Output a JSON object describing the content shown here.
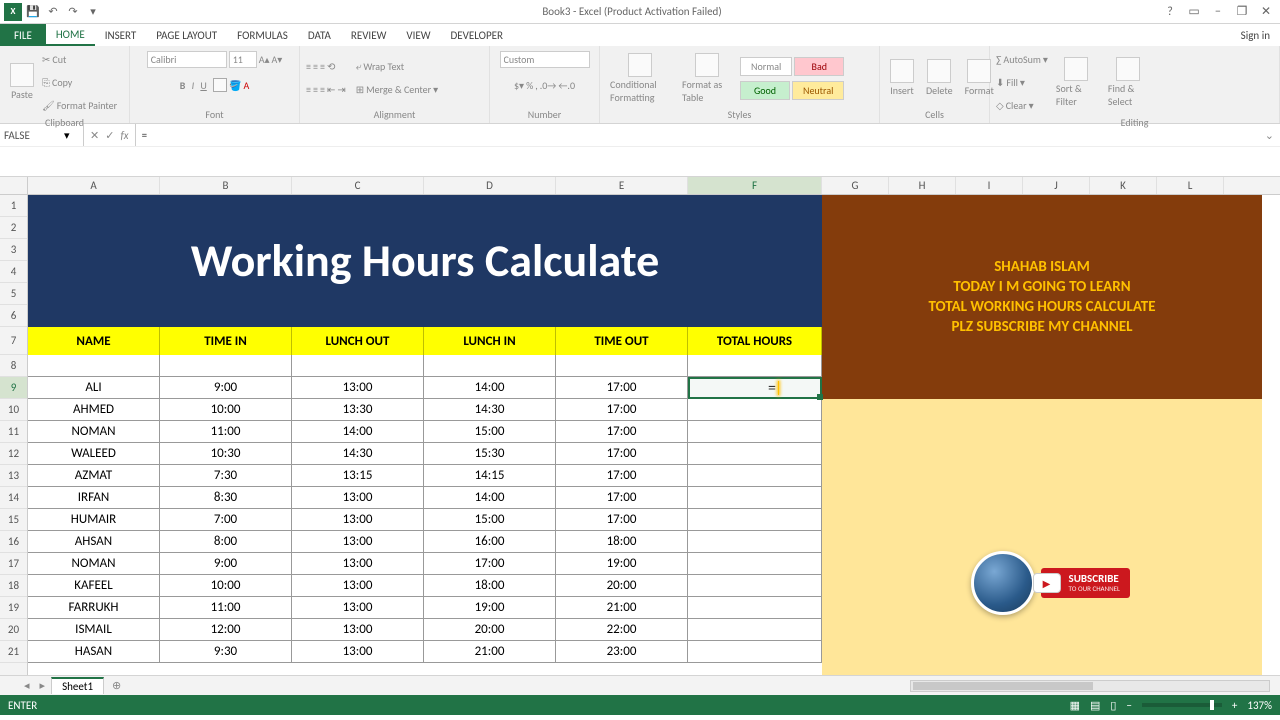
{
  "title_bar": {
    "app_title": "Book3 - Excel (Product Activation Failed)"
  },
  "window_controls": {
    "help": "?",
    "ribbon_opts": "▭",
    "minimize": "−",
    "restore": "❐",
    "close": "✕"
  },
  "tabs": {
    "file": "FILE",
    "home": "HOME",
    "insert": "INSERT",
    "page_layout": "PAGE LAYOUT",
    "formulas": "FORMULAS",
    "data": "DATA",
    "review": "REVIEW",
    "view": "VIEW",
    "developer": "DEVELOPER",
    "signin": "Sign in"
  },
  "ribbon": {
    "clipboard": {
      "label": "Clipboard",
      "paste": "Paste",
      "cut": "Cut",
      "copy": "Copy",
      "format_painter": "Format Painter"
    },
    "font": {
      "label": "Font",
      "family": "Calibri",
      "size": "11"
    },
    "alignment": {
      "label": "Alignment",
      "wrap": "Wrap Text",
      "merge": "Merge & Center"
    },
    "number": {
      "label": "Number",
      "format": "Custom"
    },
    "styles": {
      "label": "Styles",
      "cond": "Conditional Formatting",
      "table": "Format as Table",
      "normal": "Normal",
      "bad": "Bad",
      "good": "Good",
      "neutral": "Neutral"
    },
    "cells": {
      "label": "Cells",
      "insert": "Insert",
      "delete": "Delete",
      "format": "Format"
    },
    "editing": {
      "label": "Editing",
      "autosum": "AutoSum",
      "fill": "Fill",
      "clear": "Clear",
      "sort": "Sort & Filter",
      "find": "Find & Select"
    }
  },
  "formula_bar": {
    "name_box": "FALSE",
    "cancel": "✕",
    "enter": "✓",
    "fx": "fx",
    "formula": "="
  },
  "columns": [
    "A",
    "B",
    "C",
    "D",
    "E",
    "F",
    "G",
    "H",
    "I",
    "J",
    "K",
    "L"
  ],
  "rows_visible": [
    1,
    2,
    3,
    4,
    5,
    6,
    7,
    8,
    9,
    10,
    11,
    12,
    13,
    14,
    15,
    16,
    17,
    18,
    19,
    20,
    21
  ],
  "active_cell_row": 9,
  "active_cell_col": "F",
  "active_cell_content": "=",
  "banner_title": "Working Hours Calculate",
  "headers": {
    "name": "NAME",
    "time_in": "TIME IN",
    "lunch_out": "LUNCH OUT",
    "lunch_in": "LUNCH IN",
    "time_out": "TIME OUT",
    "total_hours": "TOTAL HOURS"
  },
  "side_banner": {
    "l1": "SHAHAB ISLAM",
    "l2": "TODAY I M GOING TO LEARN",
    "l3": "TOTAL WORKING HOURS CALCULATE",
    "l4": "PLZ SUBSCRIBE MY CHANNEL"
  },
  "subscribe": {
    "line1": "SUBSCRIBE",
    "line2": "TO OUR CHANNEL"
  },
  "data_rows": [
    {
      "name": "ALI",
      "in": "9:00",
      "lo": "13:00",
      "li": "14:00",
      "out": "17:00"
    },
    {
      "name": "AHMED",
      "in": "10:00",
      "lo": "13:30",
      "li": "14:30",
      "out": "17:00"
    },
    {
      "name": "NOMAN",
      "in": "11:00",
      "lo": "14:00",
      "li": "15:00",
      "out": "17:00"
    },
    {
      "name": "WALEED",
      "in": "10:30",
      "lo": "14:30",
      "li": "15:30",
      "out": "17:00"
    },
    {
      "name": "AZMAT",
      "in": "7:30",
      "lo": "13:15",
      "li": "14:15",
      "out": "17:00"
    },
    {
      "name": "IRFAN",
      "in": "8:30",
      "lo": "13:00",
      "li": "14:00",
      "out": "17:00"
    },
    {
      "name": "HUMAIR",
      "in": "7:00",
      "lo": "13:00",
      "li": "15:00",
      "out": "17:00"
    },
    {
      "name": "AHSAN",
      "in": "8:00",
      "lo": "13:00",
      "li": "16:00",
      "out": "18:00"
    },
    {
      "name": "NOMAN",
      "in": "9:00",
      "lo": "13:00",
      "li": "17:00",
      "out": "19:00"
    },
    {
      "name": "KAFEEL",
      "in": "10:00",
      "lo": "13:00",
      "li": "18:00",
      "out": "20:00"
    },
    {
      "name": "FARRUKH",
      "in": "11:00",
      "lo": "13:00",
      "li": "19:00",
      "out": "21:00"
    },
    {
      "name": "ISMAIL",
      "in": "12:00",
      "lo": "13:00",
      "li": "20:00",
      "out": "22:00"
    },
    {
      "name": "HASAN",
      "in": "9:30",
      "lo": "13:00",
      "li": "21:00",
      "out": "23:00"
    }
  ],
  "sheet_tabs": {
    "sheet1": "Sheet1",
    "add": "⊕"
  },
  "status_bar": {
    "mode": "ENTER",
    "zoom": "137%"
  }
}
